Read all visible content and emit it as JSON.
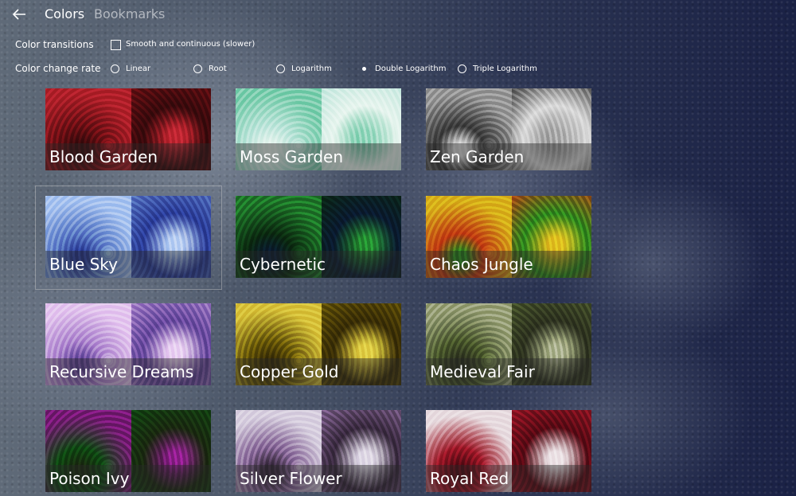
{
  "header": {
    "back_icon": "back-arrow-icon",
    "tabs": [
      {
        "label": "Colors",
        "active": true
      },
      {
        "label": "Bookmarks",
        "active": false
      }
    ]
  },
  "options": {
    "transitions_label": "Color transitions",
    "smooth_checkbox_label": "Smooth and continuous (slower)",
    "smooth_checked": false,
    "rate_label": "Color change rate",
    "rates": [
      {
        "label": "Linear",
        "selected": false
      },
      {
        "label": "Root",
        "selected": false
      },
      {
        "label": "Logarithm",
        "selected": false
      },
      {
        "label": "Double Logarithm",
        "selected": true
      },
      {
        "label": "Triple Logarithm",
        "selected": false
      }
    ]
  },
  "palettes": [
    {
      "name": "Blood Garden",
      "colors": [
        "#6e0f14",
        "#b2202a",
        "#3a0a0c"
      ]
    },
    {
      "name": "Moss Garden",
      "colors": [
        "#bfe6dc",
        "#7fcfb0",
        "#e8f5ef"
      ]
    },
    {
      "name": "Zen Garden",
      "colors": [
        "#3b3b3b",
        "#9a9a9a",
        "#dcdcdc"
      ]
    },
    {
      "name": "Blue Sky",
      "colors": [
        "#5f7fc8",
        "#a9c4f0",
        "#2b3d9a"
      ]
    },
    {
      "name": "Cybernetic",
      "colors": [
        "#0b2a10",
        "#1f7a2a",
        "#0a1a30"
      ]
    },
    {
      "name": "Chaos Jungle",
      "colors": [
        "#c23a12",
        "#d9b21a",
        "#2c8a1e"
      ]
    },
    {
      "name": "Recursive Dreams",
      "colors": [
        "#b08ad0",
        "#e4c6ef",
        "#6a4aa0"
      ]
    },
    {
      "name": "Copper Gold",
      "colors": [
        "#6b5a08",
        "#d8c23a",
        "#3a2e06"
      ]
    },
    {
      "name": "Medieval Fair",
      "colors": [
        "#4b5a2c",
        "#9aa27a",
        "#2e3320"
      ]
    },
    {
      "name": "Poison Ivy",
      "colors": [
        "#0e4a12",
        "#7a1a78",
        "#1a2a10"
      ]
    },
    {
      "name": "Silver Flower",
      "colors": [
        "#8a6a9a",
        "#d8d0e0",
        "#3a2a40"
      ]
    },
    {
      "name": "Royal Red",
      "colors": [
        "#a01828",
        "#e8dce0",
        "#5a0a14"
      ]
    }
  ]
}
